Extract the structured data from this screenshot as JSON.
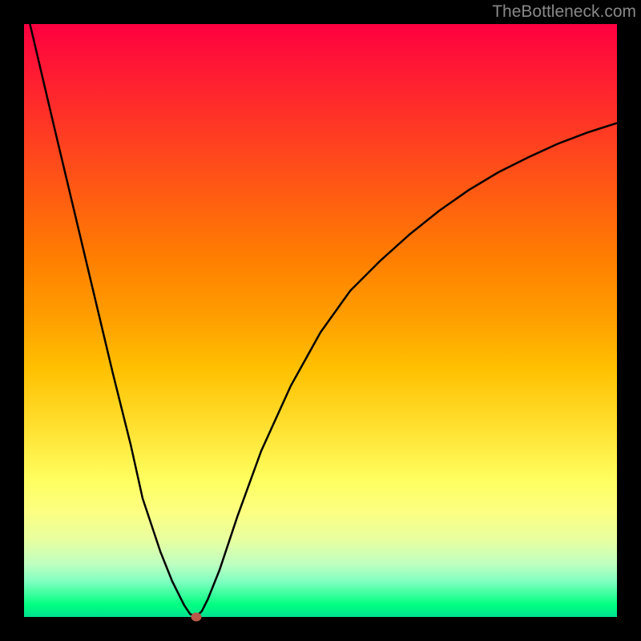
{
  "watermark": "TheBottleneck.com",
  "chart_data": {
    "type": "line",
    "title": "",
    "xlabel": "",
    "ylabel": "",
    "xlim": [
      0,
      100
    ],
    "ylim": [
      0,
      100
    ],
    "grid": false,
    "series": [
      {
        "name": "bottleneck-curve",
        "type": "line",
        "x": [
          1,
          5,
          10,
          15,
          18,
          20,
          23,
          25,
          27,
          28,
          29,
          30,
          31,
          33,
          36,
          40,
          45,
          50,
          55,
          60,
          65,
          70,
          75,
          80,
          85,
          90,
          95,
          100
        ],
        "values": [
          100,
          83,
          62,
          41,
          29,
          20,
          11,
          6,
          2,
          0.5,
          0,
          1,
          3,
          8,
          17,
          28,
          39,
          48,
          55,
          60,
          64.5,
          68.5,
          72,
          75,
          77.5,
          79.8,
          81.7,
          83.3
        ]
      }
    ],
    "marker": {
      "x": 29,
      "y": 0,
      "color": "#b85848"
    },
    "background_gradient": {
      "type": "vertical",
      "stops": [
        {
          "pos": 0,
          "color": "#ff0040"
        },
        {
          "pos": 50,
          "color": "#ffa000"
        },
        {
          "pos": 80,
          "color": "#ffff60"
        },
        {
          "pos": 100,
          "color": "#00e090"
        }
      ]
    }
  }
}
